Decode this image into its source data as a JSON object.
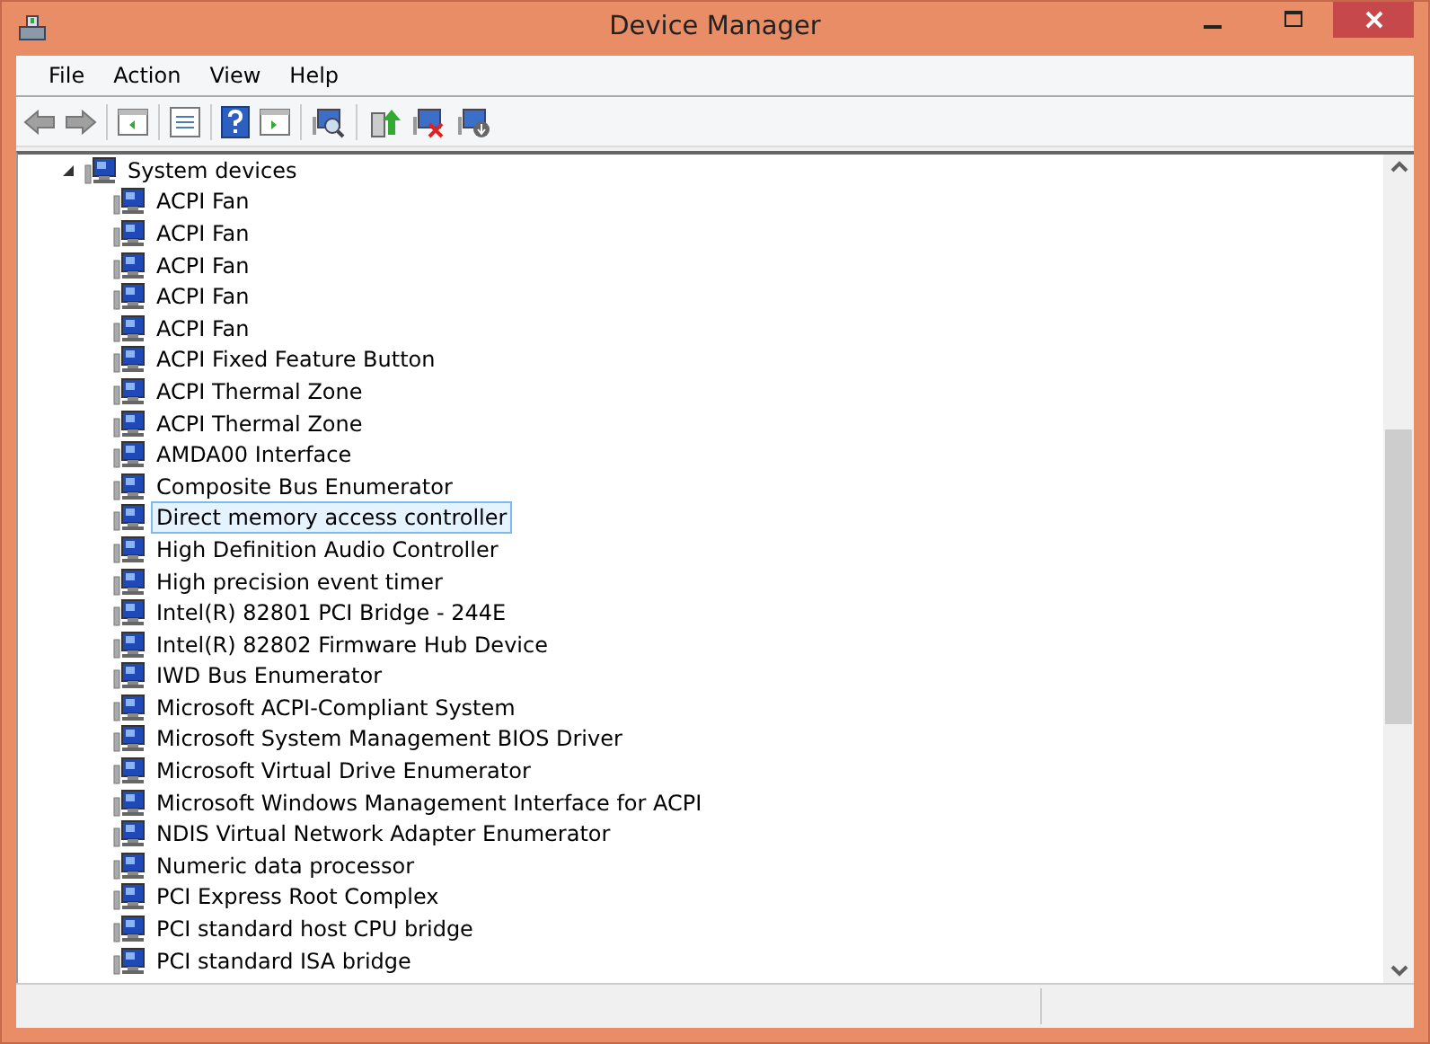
{
  "window": {
    "title": "Device Manager"
  },
  "menu": [
    "File",
    "Action",
    "View",
    "Help"
  ],
  "tree": {
    "label": "System devices",
    "expanded": true,
    "children": [
      {
        "label": "ACPI Fan",
        "selected": false
      },
      {
        "label": "ACPI Fan",
        "selected": false
      },
      {
        "label": "ACPI Fan",
        "selected": false
      },
      {
        "label": "ACPI Fan",
        "selected": false
      },
      {
        "label": "ACPI Fan",
        "selected": false
      },
      {
        "label": "ACPI Fixed Feature Button",
        "selected": false
      },
      {
        "label": "ACPI Thermal Zone",
        "selected": false
      },
      {
        "label": "ACPI Thermal Zone",
        "selected": false
      },
      {
        "label": "AMDA00 Interface",
        "selected": false
      },
      {
        "label": "Composite Bus Enumerator",
        "selected": false
      },
      {
        "label": "Direct memory access controller",
        "selected": true
      },
      {
        "label": "High Definition Audio Controller",
        "selected": false
      },
      {
        "label": "High precision event timer",
        "selected": false
      },
      {
        "label": "Intel(R) 82801 PCI Bridge - 244E",
        "selected": false
      },
      {
        "label": "Intel(R) 82802 Firmware Hub Device",
        "selected": false
      },
      {
        "label": "IWD Bus Enumerator",
        "selected": false
      },
      {
        "label": "Microsoft ACPI-Compliant System",
        "selected": false
      },
      {
        "label": "Microsoft System Management BIOS Driver",
        "selected": false
      },
      {
        "label": "Microsoft Virtual Drive Enumerator",
        "selected": false
      },
      {
        "label": "Microsoft Windows Management Interface for ACPI",
        "selected": false
      },
      {
        "label": "NDIS Virtual Network Adapter Enumerator",
        "selected": false
      },
      {
        "label": "Numeric data processor",
        "selected": false
      },
      {
        "label": "PCI Express Root Complex",
        "selected": false
      },
      {
        "label": "PCI standard host CPU bridge",
        "selected": false
      },
      {
        "label": "PCI standard ISA bridge",
        "selected": false
      }
    ]
  }
}
